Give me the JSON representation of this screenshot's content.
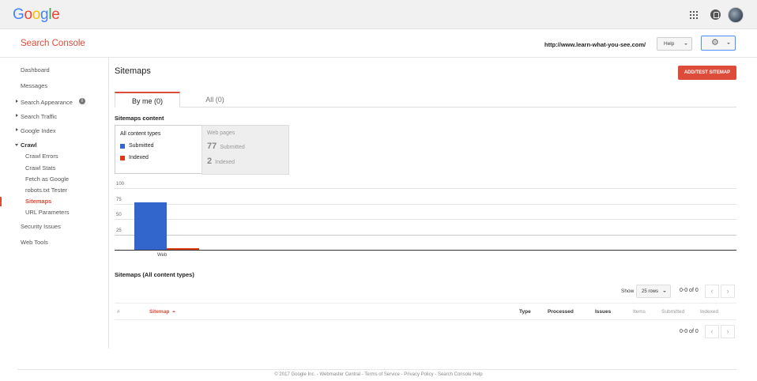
{
  "header": {
    "logo_letters": [
      {
        "ch": "G",
        "cls": "b"
      },
      {
        "ch": "o",
        "cls": "r"
      },
      {
        "ch": "o",
        "cls": "y"
      },
      {
        "ch": "g",
        "cls": "b"
      },
      {
        "ch": "l",
        "cls": "g"
      },
      {
        "ch": "e",
        "cls": "r"
      }
    ],
    "app_title": "Search Console",
    "site_url": "http://www.learn-what-you-see.com/",
    "help_label": "Help",
    "gear_glyph": "⚙"
  },
  "sidebar": {
    "dashboard": "Dashboard",
    "messages": "Messages",
    "search_appearance": "Search Appearance",
    "search_traffic": "Search Traffic",
    "google_index": "Google Index",
    "crawl": "Crawl",
    "crawl_errors": "Crawl Errors",
    "crawl_stats": "Crawl Stats",
    "fetch_as_google": "Fetch as Google",
    "robots_tester": "robots.txt Tester",
    "sitemaps": "Sitemaps",
    "url_parameters": "URL Parameters",
    "security_issues": "Security Issues",
    "web_tools": "Web Tools",
    "info_glyph": "i"
  },
  "main": {
    "title": "Sitemaps",
    "add_button": "ADD/TEST SITEMAP",
    "tab_by_me": "By me (0)",
    "tab_all": "All (0)",
    "content_title": "Sitemaps content",
    "all_content_types": "All content types",
    "legend_submitted": "Submitted",
    "legend_indexed": "Indexed",
    "web_pages": "Web pages",
    "web_submitted_num": "77",
    "web_submitted_label": "Submitted",
    "web_indexed_num": "2",
    "web_indexed_label": "Indexed",
    "colors": {
      "submitted": "#3366cc",
      "indexed": "#dc3912",
      "accent": "#dd4b39"
    }
  },
  "chart_data": {
    "type": "bar",
    "categories": [
      "Web"
    ],
    "series": [
      {
        "name": "Submitted",
        "values": [
          77
        ]
      },
      {
        "name": "Indexed",
        "values": [
          2
        ]
      }
    ],
    "yticks": [
      "100",
      "75",
      "50",
      "25"
    ],
    "ylim": [
      0,
      100
    ],
    "grid": true
  },
  "table": {
    "title": "Sitemaps (All content types)",
    "show_label": "Show",
    "rows_value": "25 rows",
    "pager_text": "0-0 of 0",
    "prev_glyph": "‹",
    "next_glyph": "›",
    "columns": {
      "hash": "#",
      "sitemap": "Sitemap",
      "type": "Type",
      "processed": "Processed",
      "issues": "Issues",
      "items": "Items",
      "submitted": "Submitted",
      "indexed": "Indexed"
    }
  },
  "footer": {
    "text": "© 2017 Google Inc. - Webmaster Central - Terms of Service - Privacy Policy - Search Console Help"
  }
}
